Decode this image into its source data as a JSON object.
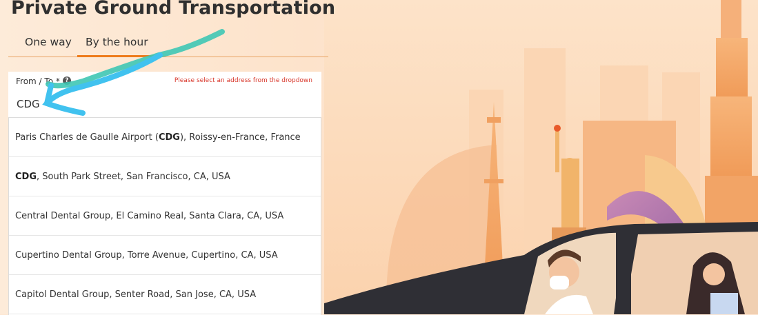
{
  "page": {
    "title": "Private Ground Transportation"
  },
  "tabs": [
    {
      "label": "One way",
      "active": false
    },
    {
      "label": "By the hour",
      "active": true
    }
  ],
  "field": {
    "label": "From / To *",
    "help": "?",
    "error": "Please select an address from the dropdown",
    "value": "CDG"
  },
  "suggestions": [
    {
      "pre": "Paris Charles de Gaulle Airport (",
      "match": "CDG",
      "post": "), Roissy-en-France, France"
    },
    {
      "pre": "",
      "match": "CDG",
      "post": ", South Park Street, San Francisco, CA, USA"
    },
    {
      "pre": "Central Dental Group, El Camino Real, Santa Clara, CA, USA",
      "match": "",
      "post": ""
    },
    {
      "pre": "Cupertino Dental Group, Torre Avenue, Cupertino, CA, USA",
      "match": "",
      "post": ""
    },
    {
      "pre": "Capitol Dental Group, Senter Road, San Jose, CA, USA",
      "match": "",
      "post": ""
    }
  ],
  "colors": {
    "accent": "#ee7b1b",
    "error": "#d8362a",
    "annotation_teal": "#3fc6b4",
    "annotation_blue": "#41c2ef"
  }
}
